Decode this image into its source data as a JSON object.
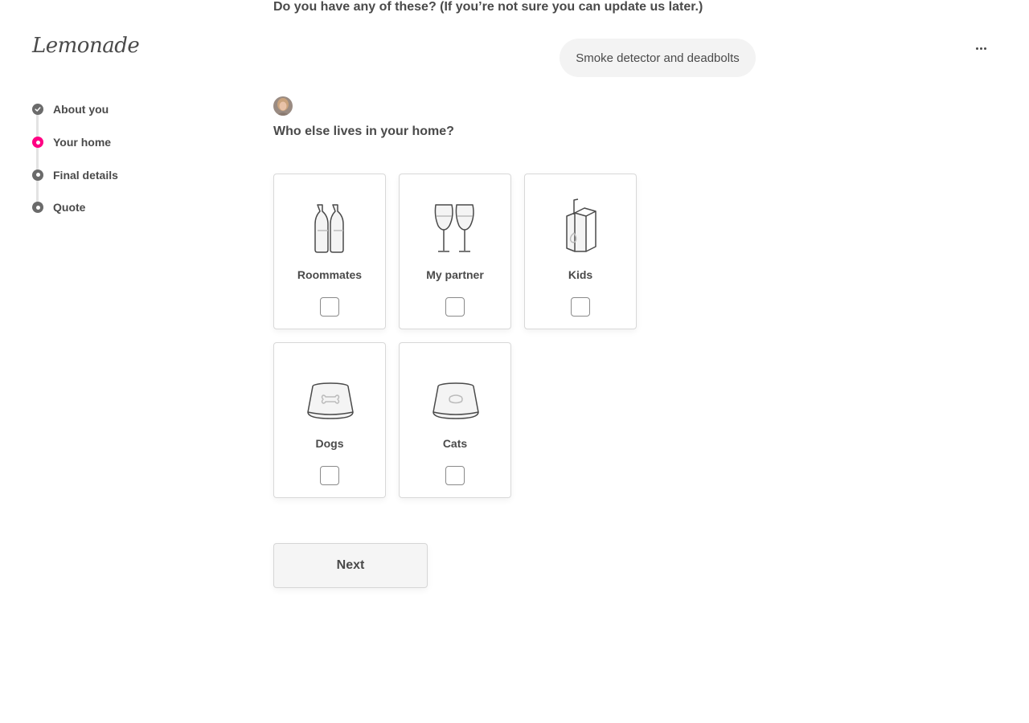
{
  "header": {
    "logo_text": "Lemonade",
    "more_icon": "more-horizontal-icon"
  },
  "progress": {
    "steps": [
      {
        "label": "About you",
        "state": "done"
      },
      {
        "label": "Your home",
        "state": "current"
      },
      {
        "label": "Final details",
        "state": "todo"
      },
      {
        "label": "Quote",
        "state": "todo"
      }
    ],
    "current_color": "#ff0083"
  },
  "chat": {
    "previous_question": "Do you have any of these? (If you’re not sure you can update us later.)",
    "previous_answer": "Smoke detector and deadbolts",
    "question": "Who else lives in your home?"
  },
  "options": [
    {
      "label": "Roommates",
      "icon": "bottles-icon",
      "checked": false
    },
    {
      "label": "My partner",
      "icon": "wine-glasses-icon",
      "checked": false
    },
    {
      "label": "Kids",
      "icon": "juice-box-icon",
      "checked": false
    },
    {
      "label": "Dogs",
      "icon": "dog-bowl-icon",
      "checked": false
    },
    {
      "label": "Cats",
      "icon": "cat-bowl-icon",
      "checked": false
    }
  ],
  "actions": {
    "next_label": "Next"
  }
}
